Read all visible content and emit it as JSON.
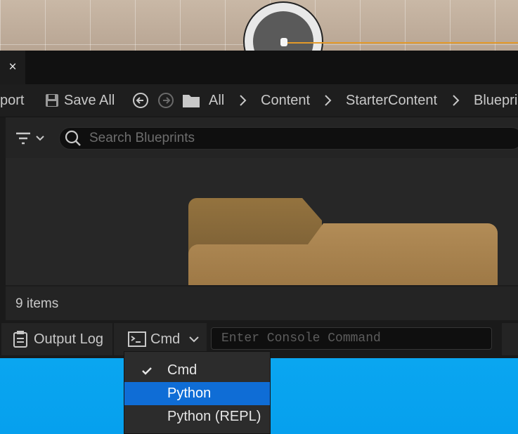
{
  "tab": {
    "close_label": "×"
  },
  "toolbar": {
    "import_label": "port",
    "save_all_label": "Save All",
    "breadcrumbs": [
      "All",
      "Content",
      "StarterContent",
      "Blueprin"
    ]
  },
  "search": {
    "placeholder": "Search Blueprints"
  },
  "status": {
    "item_count": "9 items"
  },
  "bottom": {
    "output_log_label": "Output Log",
    "cmd_label": "Cmd",
    "console_placeholder": "Enter Console Command"
  },
  "menu": {
    "items": [
      {
        "label": "Cmd",
        "checked": true
      },
      {
        "label": "Python",
        "highlighted": true
      },
      {
        "label": "Python (REPL)"
      }
    ]
  },
  "colors": {
    "accent": "#0f6dd6",
    "folder": "#a8834f",
    "selection": "#e39a2a",
    "viewport_sky": "#0aa6f0"
  }
}
